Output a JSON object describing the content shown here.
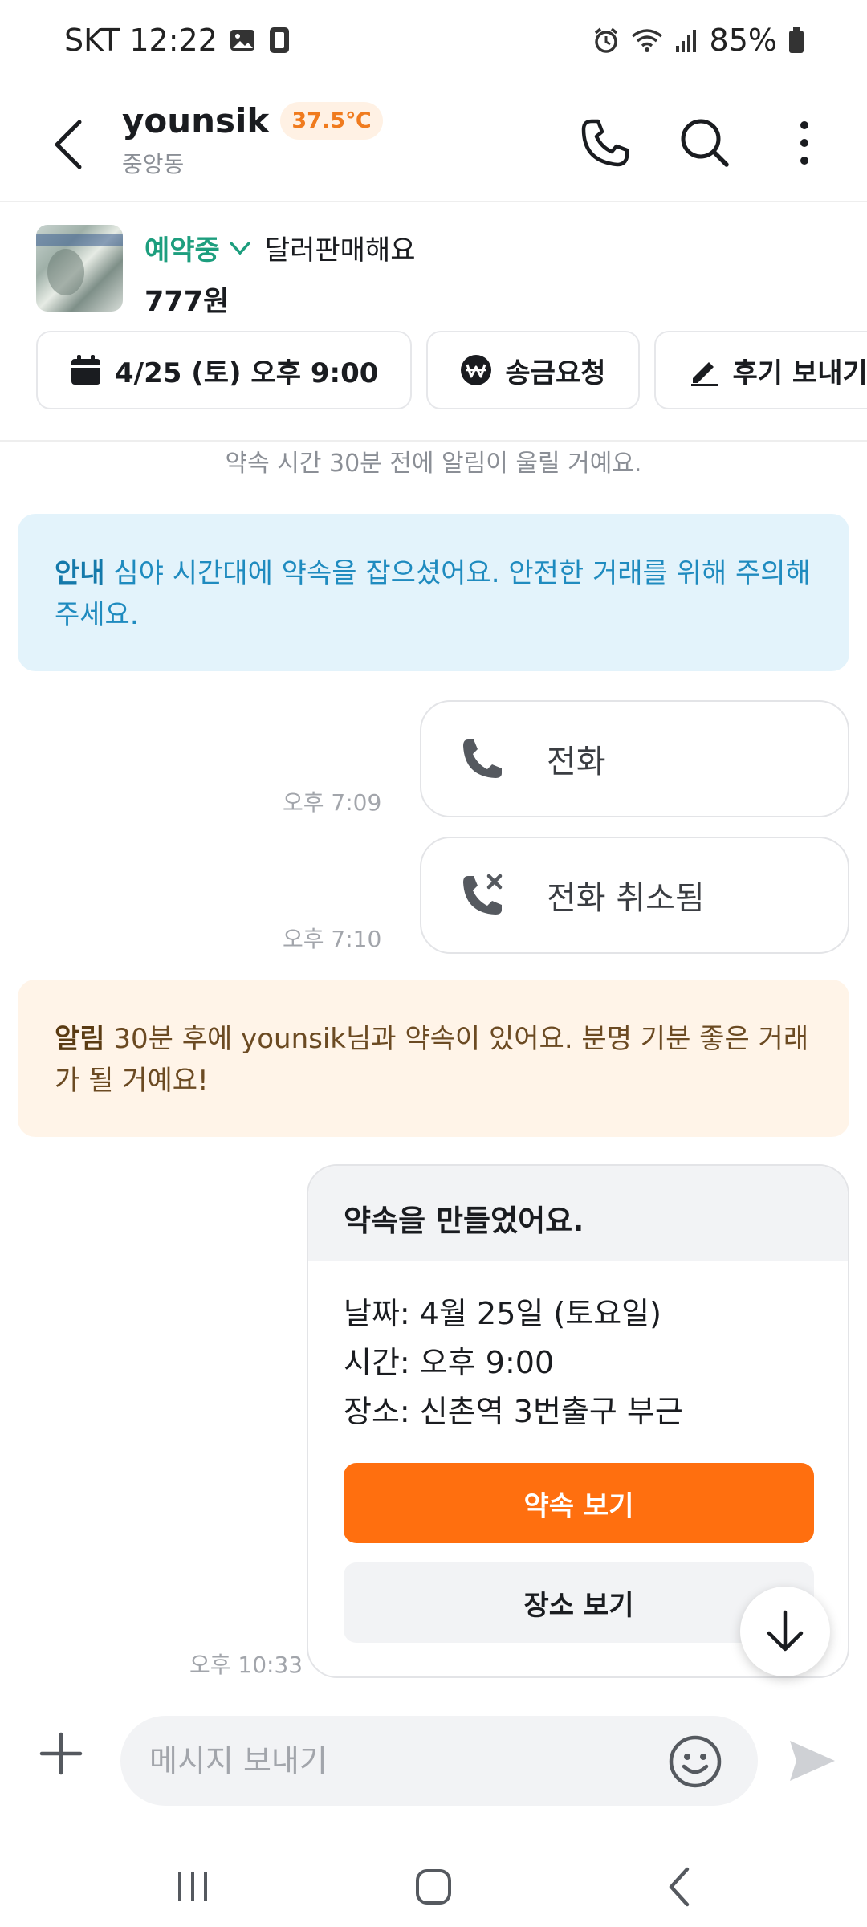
{
  "status_bar": {
    "carrier_time": "SKT 12:22",
    "battery": "85%"
  },
  "header": {
    "username": "younsik",
    "temperature": "37.5℃",
    "location": "중앙동"
  },
  "product": {
    "status": "예약중",
    "title": "달러판매해요",
    "price": "777원"
  },
  "actions": [
    {
      "label": "4/25 (토) 오후 9:00",
      "icon": "calendar-icon"
    },
    {
      "label": "송금요청",
      "icon": "won-icon"
    },
    {
      "label": "후기 보내기",
      "icon": "pencil-icon"
    }
  ],
  "chat": {
    "reminder_notice": "약속 시간 30분 전에 알림이 울릴 거예요.",
    "info_box": {
      "label": "안내",
      "text": "심야 시간대에 약속을 잡으셨어요. 안전한 거래를 위해 주의해주세요."
    },
    "call_1": {
      "label": "전화",
      "time": "오후 7:09"
    },
    "call_2": {
      "label": "전화 취소됨",
      "time": "오후 7:10"
    },
    "alarm_box": {
      "label": "알림",
      "text": "30분 후에 younsik님과 약속이 있어요. 분명 기분 좋은 거래가 될 거예요!"
    },
    "appointment": {
      "title": "약속을 만들었어요.",
      "date": "날짜: 4월 25일 (토요일)",
      "time": "시간: 오후 9:00",
      "place": "장소: 신촌역 3번출구 부근",
      "view_appointment": "약속 보기",
      "view_place": "장소 보기",
      "sent_time": "오후 10:33"
    }
  },
  "input": {
    "placeholder": "메시지 보내기"
  },
  "colors": {
    "accent": "#ff6f0f",
    "reserved": "#1d9e7e",
    "info_bg": "#e3f3fb",
    "alarm_bg": "#fff4e8"
  }
}
